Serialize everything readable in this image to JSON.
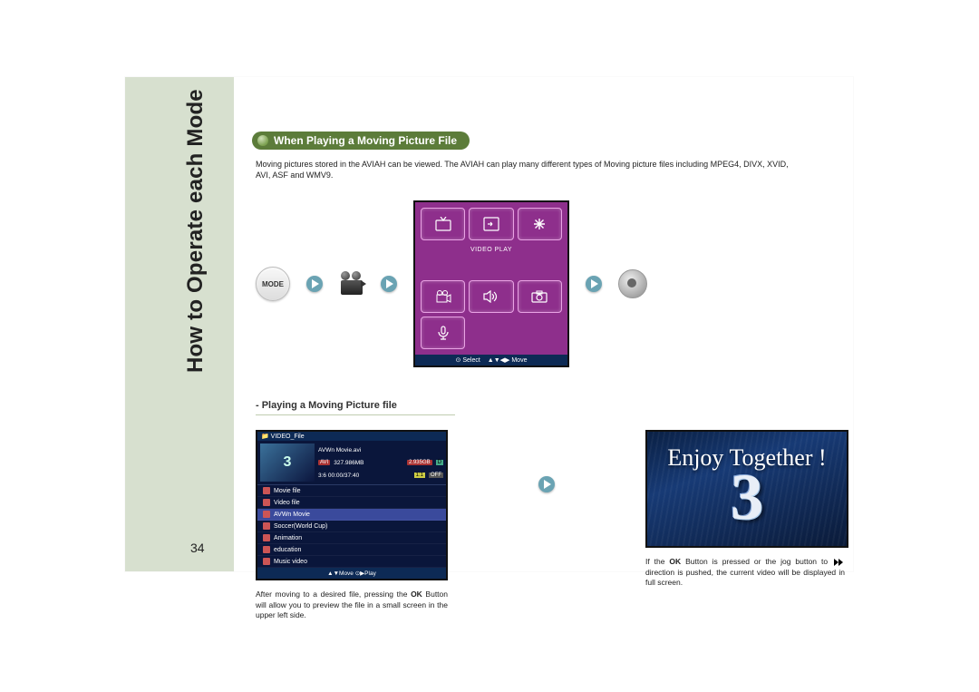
{
  "sidebar": {
    "title": "How to Operate each Mode",
    "page_number": "34"
  },
  "section": {
    "pill": "When Playing a Moving Picture File",
    "intro": "Moving pictures stored in the AVIAH can be viewed. The AVIAH can play many different types of Moving picture files including MPEG4, DIVX, XVID, AVI, ASF and WMV9."
  },
  "flow": {
    "mode_label": "MODE",
    "menu_label": "VIDEO PLAY",
    "menu_footer_select": "⊙ Select",
    "menu_footer_move": "▲▼◀▶ Move"
  },
  "subhead": "- Playing a Moving Picture file",
  "filebrowser": {
    "header": "VIDEO_File",
    "file_title": "AVWn Movie.avi",
    "badge1": "AVI",
    "size": "327.986MB",
    "badge2": "2.935GB",
    "time": "3:6   00:00/37:40",
    "items": [
      "Movie file",
      "Video file",
      "AVWn Movie",
      "Soccer(World Cup)",
      "Animation",
      "education",
      "Music video"
    ],
    "selected_index": 2,
    "footer": "▲▼Move  ⊙▶Play"
  },
  "captions": {
    "left_a": "After moving to a desired file, pressing the ",
    "left_bold": "OK",
    "left_b": " Button will allow you to preview the file in a small screen in the upper left side.",
    "right_a": "If the ",
    "right_bold": "OK",
    "right_b": " Button is pressed or the jog button to ",
    "right_c": "direction is pushed, the current video will be displayed in full screen."
  },
  "playback": {
    "overlay_text": "Enjoy Together !",
    "big_number": "3"
  }
}
